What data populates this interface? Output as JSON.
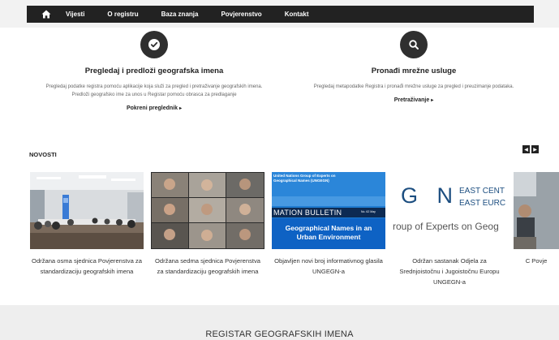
{
  "nav": {
    "home_icon": "home-icon",
    "items": [
      "Vijesti",
      "O registru",
      "Baza znanja",
      "Povjerenstvo",
      "Kontakt"
    ]
  },
  "features": [
    {
      "icon": "check-icon",
      "title": "Pregledaj i predloži geografska imena",
      "description": "Pregledaj podatke registra pomoću aplikacije koja služi za pregled i pretraživanje geografskih imena. Predloži geografsko ime za unos u Registar pomoću obrasca za predlaganje",
      "link": "Pokreni preglednik"
    },
    {
      "icon": "search-icon",
      "title": "Pronađi mrežne usluge",
      "description": "Pregledaj metapodatke Registra i pronađi mrežne usluge za pregled i preuzimanje podataka.",
      "link": "Pretraživanje"
    }
  ],
  "news": {
    "title": "NOVOSTI",
    "items": [
      {
        "caption": "Održana osma sjednica Povjerenstva za standardizaciju geografskih imena"
      },
      {
        "caption": "Održana sedma sjednica Povjerenstva za standardizaciju geografskih imena"
      },
      {
        "caption": "Objavljen novi broj informativnog glasila UNGEGN-a",
        "image_text": {
          "top": "United Nations Group of Experts on Geographical Names (UNGEGN)",
          "banner": "MATION BULLETIN",
          "issue": "No. 62  May",
          "box": "Geographical Names in an Urban Environment"
        }
      },
      {
        "caption": "Održan sastanak Odjela za Srednjoistočnu i Jugoistočnu Europu UNGEGN-a",
        "image_text": {
          "letters": "G N",
          "right1": "EAST CENT",
          "right2": "EAST EURC",
          "bottom": "roup of Experts on Geog"
        }
      },
      {
        "caption": "C Povje"
      }
    ]
  },
  "footer": {
    "title": "REGISTAR GEOGRAFSKIH IMENA"
  }
}
